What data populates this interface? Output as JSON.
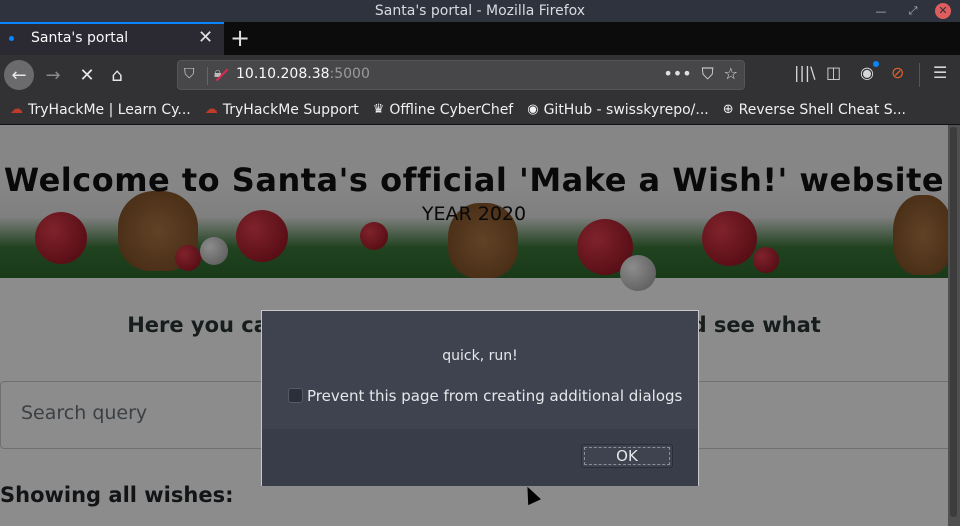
{
  "window": {
    "title": "Santa's portal - Mozilla Firefox"
  },
  "tabs": [
    {
      "label": "Santa's portal",
      "active": true
    }
  ],
  "toolbar": {
    "url_host": "10.10.208.38",
    "url_port": ":5000",
    "new_tab": "+",
    "accent": "#0a84ff"
  },
  "bookmarks": [
    {
      "label": "TryHackMe | Learn Cy...",
      "icon": "tryhackme-icon"
    },
    {
      "label": "TryHackMe Support",
      "icon": "tryhackme-icon"
    },
    {
      "label": "Offline CyberChef",
      "icon": "chef-hat-icon"
    },
    {
      "label": "GitHub - swisskyrepo/...",
      "icon": "github-icon"
    },
    {
      "label": "Reverse Shell Cheat S...",
      "icon": "globe-icon"
    }
  ],
  "page": {
    "heading": "Welcome to Santa's official 'Make a Wish!' website",
    "year": "YEAR 2020",
    "subheading": "Here you can anonymously post your wishes and see what",
    "search_placeholder": "Search query",
    "showing": "Showing all wishes:"
  },
  "dialog": {
    "message": "quick, run!",
    "checkbox_label": "Prevent this page from creating additional dialogs",
    "checkbox_checked": false,
    "ok_label": "OK"
  }
}
